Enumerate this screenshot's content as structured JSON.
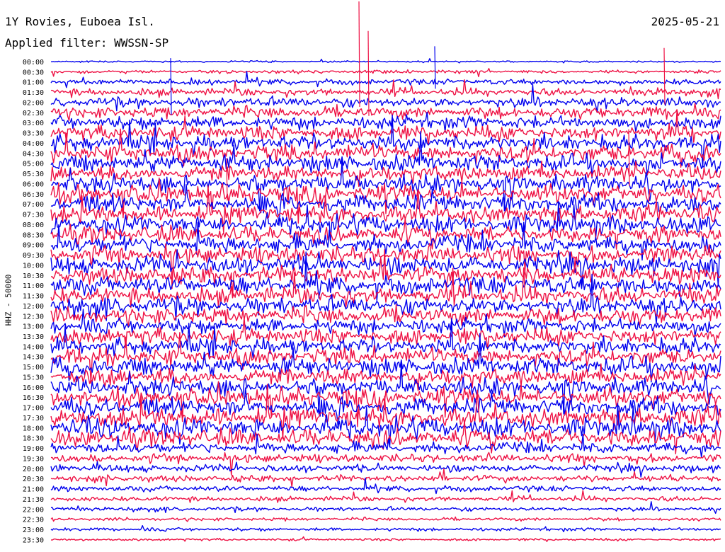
{
  "header": {
    "station": "1Y Rovies, Euboea Isl.",
    "date": "2025-05-21",
    "filter_label": "Applied filter: WWSSN-SP"
  },
  "colors": {
    "trace_a": "#0000ee",
    "trace_b": "#ee1144",
    "background": "#ffffff",
    "text": "#000000"
  },
  "chart_data": {
    "type": "line",
    "title": "1Y Rovies, Euboea Isl.",
    "date": "2025-05-21",
    "filter": "WWSSN-SP",
    "ylabel": "HHZ - 50000",
    "row_labels": [
      "00:00",
      "00:30",
      "01:00",
      "01:30",
      "02:00",
      "02:30",
      "03:00",
      "03:30",
      "04:00",
      "04:30",
      "05:00",
      "05:30",
      "06:00",
      "06:30",
      "07:00",
      "07:30",
      "08:00",
      "08:30",
      "09:00",
      "09:30",
      "10:00",
      "10:30",
      "11:00",
      "11:30",
      "12:00",
      "12:30",
      "13:00",
      "13:30",
      "14:00",
      "14:30",
      "15:00",
      "15:30",
      "16:00",
      "16:30",
      "17:00",
      "17:30",
      "18:00",
      "18:30",
      "19:00",
      "19:30",
      "20:00",
      "20:30",
      "21:00",
      "21:30",
      "22:00",
      "22:30",
      "23:00",
      "23:30"
    ],
    "row_colors_cycle": [
      "#0000ee",
      "#ee1144"
    ],
    "relative_amplitude": [
      0.2,
      0.4,
      0.7,
      0.9,
      1.2,
      1.4,
      1.6,
      1.8,
      1.9,
      2.0,
      2.0,
      1.9,
      2.1,
      2.2,
      2.2,
      2.0,
      2.1,
      2.0,
      2.1,
      2.0,
      2.2,
      2.1,
      2.2,
      2.0,
      2.1,
      2.0,
      1.8,
      2.0,
      1.9,
      2.0,
      2.1,
      2.0,
      2.1,
      2.2,
      2.2,
      2.3,
      2.3,
      2.1,
      1.3,
      1.0,
      0.9,
      0.8,
      0.7,
      0.6,
      0.5,
      0.4,
      0.4,
      0.3
    ],
    "grid": false,
    "legend": "none"
  }
}
